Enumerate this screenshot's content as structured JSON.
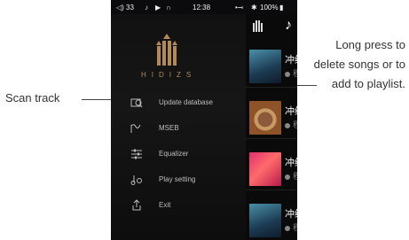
{
  "callouts": {
    "left": "Scan track",
    "right_lines": [
      "Long press to",
      "delete songs or to",
      "add to playlist."
    ]
  },
  "status_bar": {
    "left": "◁) 33",
    "icons": [
      "music-note-icon",
      "play-icon",
      "headphone-icon"
    ],
    "time": "12:38",
    "right": "100%"
  },
  "brand": {
    "name": "HIDIZS"
  },
  "menu": [
    {
      "label": "Update database",
      "icon": "scan-track-icon"
    },
    {
      "label": "MSEB",
      "icon": "mseb-icon"
    },
    {
      "label": "Equalizer",
      "icon": "equalizer-icon"
    },
    {
      "label": "Play setting",
      "icon": "play-setting-icon"
    },
    {
      "label": "Exit",
      "icon": "exit-icon"
    }
  ],
  "songs": [
    {
      "title": "冲绳",
      "subtitle": "程"
    },
    {
      "title": "冲绳",
      "subtitle": "程"
    },
    {
      "title": "冲绳",
      "subtitle": "程"
    },
    {
      "title": "冲绳",
      "subtitle": "程"
    }
  ],
  "colors": {
    "accent": "#b38a55",
    "bg": "#0b0b0d"
  }
}
